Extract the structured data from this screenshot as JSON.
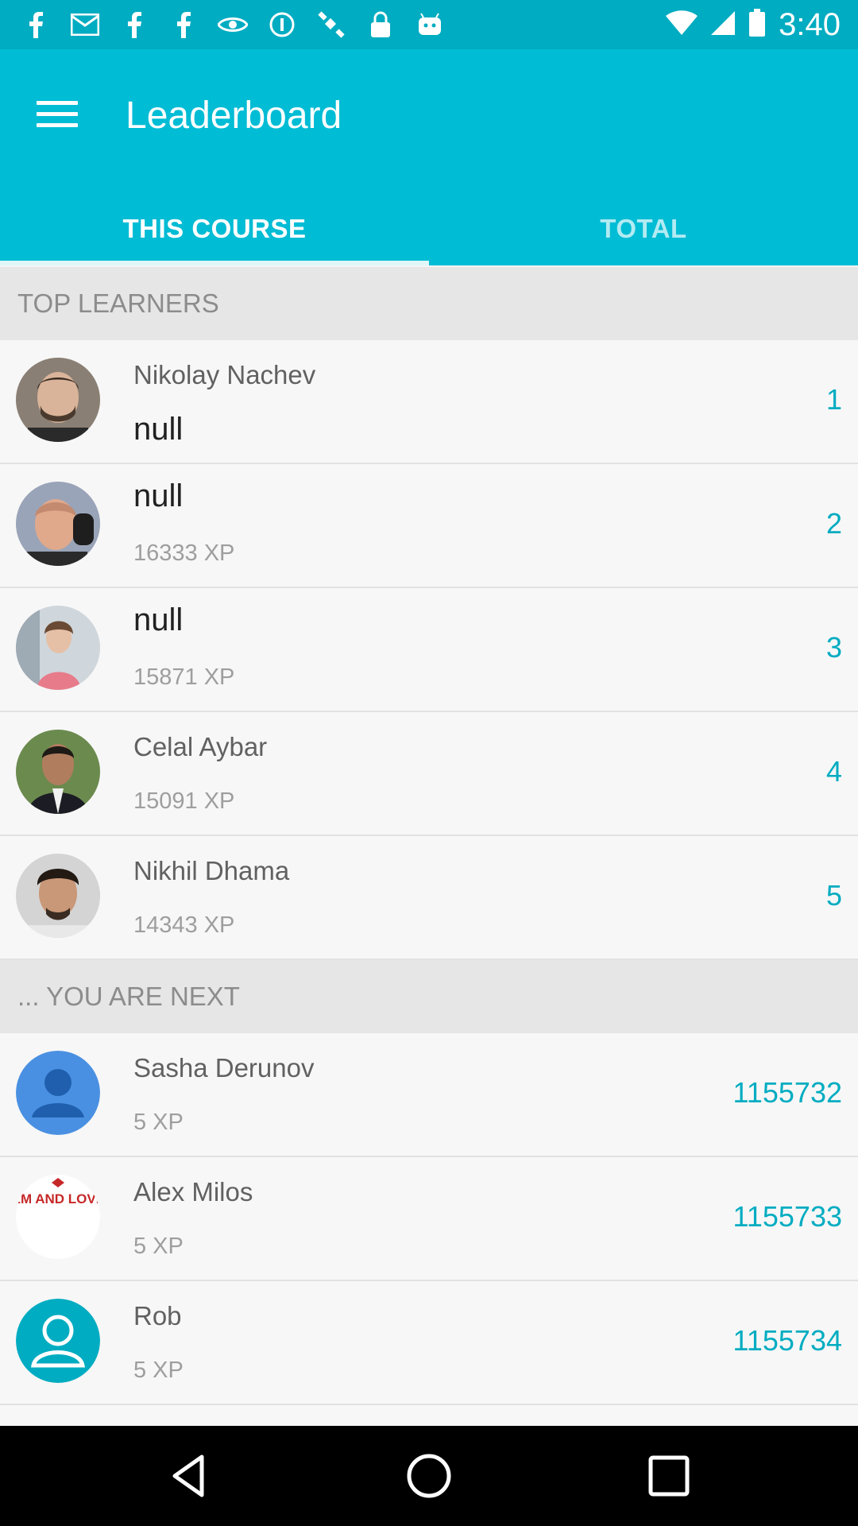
{
  "status_bar": {
    "time": "3:40"
  },
  "app_bar": {
    "title": "Leaderboard"
  },
  "tabs": [
    {
      "label": "THIS COURSE"
    },
    {
      "label": "TOTAL"
    }
  ],
  "top_learners": {
    "header": "TOP LEARNERS",
    "rows": [
      {
        "name": "Nikolay Nachev",
        "xp": "null",
        "rank": "1"
      },
      {
        "name": "null",
        "xp": "16333 XP",
        "rank": "2"
      },
      {
        "name": "null",
        "xp": "15871 XP",
        "rank": "3"
      },
      {
        "name": "Celal Aybar",
        "xp": "15091 XP",
        "rank": "4"
      },
      {
        "name": "Nikhil Dhama",
        "xp": "14343 XP",
        "rank": "5"
      }
    ]
  },
  "you_are_next": {
    "header": "... YOU ARE NEXT",
    "rows": [
      {
        "name": "Sasha Derunov",
        "xp": "5 XP",
        "rank": "1155732"
      },
      {
        "name": "Alex Milos",
        "xp": "5 XP",
        "rank": "1155733"
      },
      {
        "name": "Rob",
        "xp": "5 XP",
        "rank": "1155734"
      }
    ]
  },
  "avatar_badge_text": "KEEP CALM AND LOVE DINAMO",
  "colors": {
    "primary": "#00bcd4",
    "primary_dark": "#00acc1",
    "accent_text": "#00acc1"
  }
}
